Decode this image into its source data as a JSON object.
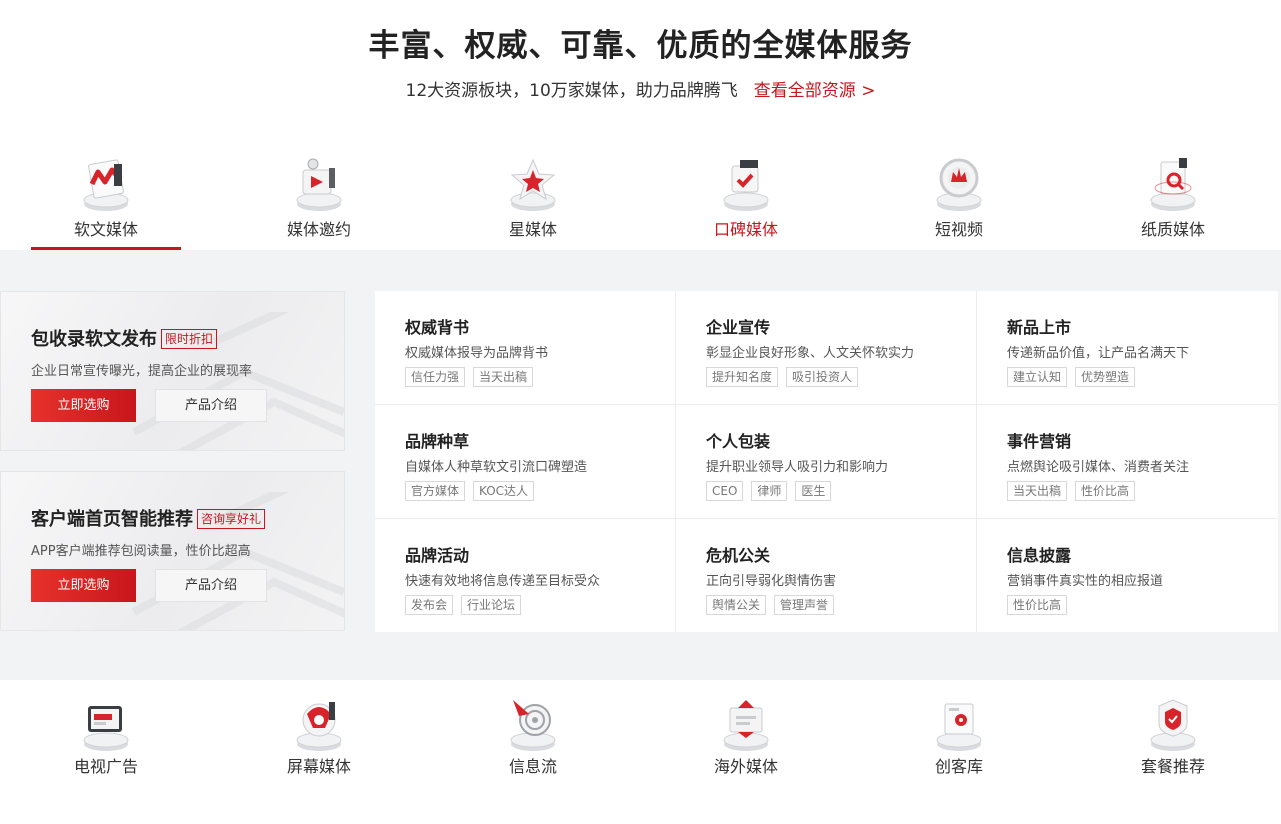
{
  "hero": {
    "title": "丰富、权威、可靠、优质的全媒体服务",
    "subtitle": "12大资源板块，10万家媒体，助力品牌腾飞",
    "link": "查看全部资源 >"
  },
  "tabs": [
    {
      "label": "软文媒体",
      "icon": "news-article-icon",
      "active": true
    },
    {
      "label": "媒体邀约",
      "icon": "media-invite-icon"
    },
    {
      "label": "星媒体",
      "icon": "star-media-icon"
    },
    {
      "label": "口碑媒体",
      "icon": "reputation-icon",
      "highlighted": true
    },
    {
      "label": "短视频",
      "icon": "short-video-icon"
    },
    {
      "label": "纸质媒体",
      "icon": "print-media-icon"
    }
  ],
  "promos": [
    {
      "title": "包收录软文发布",
      "badge": "限时折扣",
      "desc": "企业日常宣传曝光，提高企业的展现率",
      "primary": "立即选购",
      "secondary": "产品介绍"
    },
    {
      "title": "客户端首页智能推荐",
      "badge": "咨询享好礼",
      "desc": "APP客户端推荐包阅读量，性价比超高",
      "primary": "立即选购",
      "secondary": "产品介绍"
    }
  ],
  "services": [
    {
      "title": "权威背书",
      "desc": "权威媒体报导为品牌背书",
      "tags": [
        "信任力强",
        "当天出稿"
      ]
    },
    {
      "title": "企业宣传",
      "desc": "彰显企业良好形象、人文关怀软实力",
      "tags": [
        "提升知名度",
        "吸引投资人"
      ]
    },
    {
      "title": "新品上市",
      "desc": "传递新品价值，让产品名满天下",
      "tags": [
        "建立认知",
        "优势塑造"
      ]
    },
    {
      "title": "品牌种草",
      "desc": "自媒体人种草软文引流口碑塑造",
      "tags": [
        "官方媒体",
        "KOC达人"
      ]
    },
    {
      "title": "个人包装",
      "desc": "提升职业领导人吸引力和影响力",
      "tags": [
        "CEO",
        "律师",
        "医生"
      ]
    },
    {
      "title": "事件营销",
      "desc": "点燃舆论吸引媒体、消费者关注",
      "tags": [
        "当天出稿",
        "性价比高"
      ]
    },
    {
      "title": "品牌活动",
      "desc": "快速有效地将信息传递至目标受众",
      "tags": [
        "发布会",
        "行业论坛"
      ]
    },
    {
      "title": "危机公关",
      "desc": "正向引导弱化舆情伤害",
      "tags": [
        "舆情公关",
        "管理声誉"
      ]
    },
    {
      "title": "信息披露",
      "desc": "营销事件真实性的相应报道",
      "tags": [
        "性价比高"
      ]
    }
  ],
  "bottom": [
    {
      "label": "电视广告",
      "icon": "tv-ad-icon"
    },
    {
      "label": "屏幕媒体",
      "icon": "screen-media-icon"
    },
    {
      "label": "信息流",
      "icon": "feed-icon"
    },
    {
      "label": "海外媒体",
      "icon": "overseas-media-icon"
    },
    {
      "label": "创客库",
      "icon": "maker-library-icon"
    },
    {
      "label": "套餐推荐",
      "icon": "package-icon"
    }
  ],
  "colors": {
    "accent": "#c8161d",
    "panel_bg": "#f2f3f5"
  }
}
